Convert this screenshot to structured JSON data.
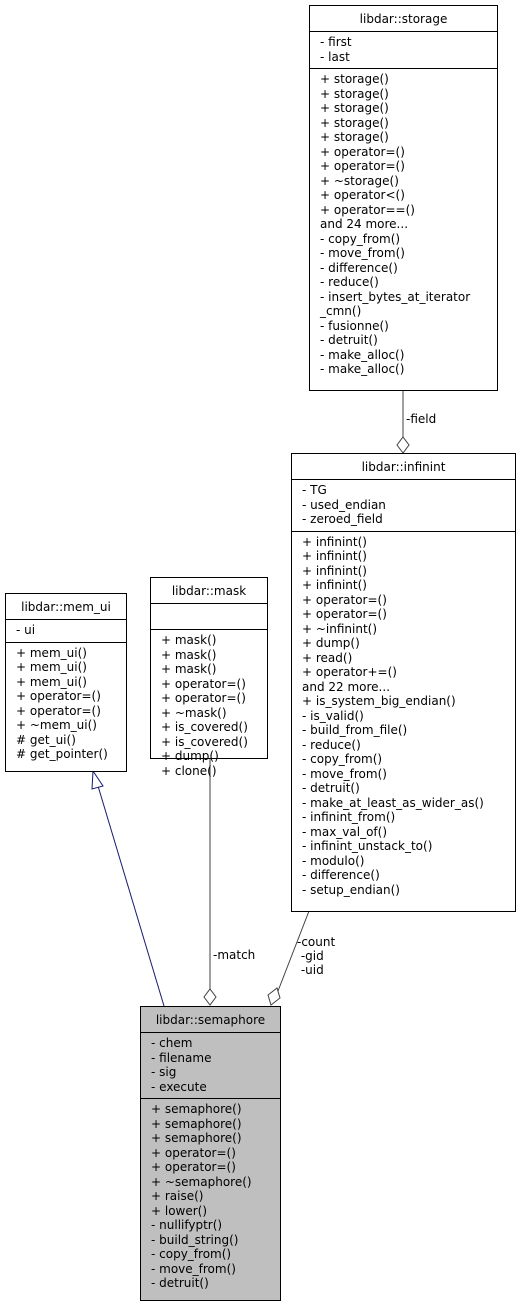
{
  "diagram": {
    "type": "uml-collaboration",
    "classes": {
      "storage": {
        "name": "libdar::storage",
        "attributes": [
          "- first",
          "- last"
        ],
        "methods": [
          "+ storage()",
          "+ storage()",
          "+ storage()",
          "+ storage()",
          "+ storage()",
          "+ operator=()",
          "+ operator=()",
          "+ ~storage()",
          "+ operator<()",
          "+ operator==()",
          "and 24 more...",
          "- copy_from()",
          "- move_from()",
          "- difference()",
          "- reduce()",
          "- insert_bytes_at_iterator",
          "_cmn()",
          "- fusionne()",
          "- detruit()",
          "- make_alloc()",
          "- make_alloc()"
        ]
      },
      "infinint": {
        "name": "libdar::infinint",
        "attributes": [
          "- TG",
          "- used_endian",
          "- zeroed_field"
        ],
        "methods": [
          "+ infinint()",
          "+ infinint()",
          "+ infinint()",
          "+ infinint()",
          "+ operator=()",
          "+ operator=()",
          "+ ~infinint()",
          "+ dump()",
          "+ read()",
          "+ operator+=()",
          "and 22 more...",
          "+ is_system_big_endian()",
          "- is_valid()",
          "- build_from_file()",
          "- reduce()",
          "- copy_from()",
          "- move_from()",
          "- detruit()",
          "- make_at_least_as_wider_as()",
          "- infinint_from()",
          "- max_val_of()",
          "- infinint_unstack_to()",
          "- modulo()",
          "- difference()",
          "- setup_endian()"
        ]
      },
      "mem_ui": {
        "name": "libdar::mem_ui",
        "attributes": [
          "- ui"
        ],
        "methods": [
          "+ mem_ui()",
          "+ mem_ui()",
          "+ mem_ui()",
          "+ operator=()",
          "+ operator=()",
          "+ ~mem_ui()",
          "# get_ui()",
          "# get_pointer()"
        ]
      },
      "mask": {
        "name": "libdar::mask",
        "attributes": [],
        "methods": [
          "+ mask()",
          "+ mask()",
          "+ mask()",
          "+ operator=()",
          "+ operator=()",
          "+ ~mask()",
          "+ is_covered()",
          "+ is_covered()",
          "+ dump()",
          "+ clone()"
        ]
      },
      "semaphore": {
        "name": "libdar::semaphore",
        "attributes": [
          "- chem",
          "- filename",
          "- sig",
          "- execute"
        ],
        "methods": [
          "+ semaphore()",
          "+ semaphore()",
          "+ semaphore()",
          "+ operator=()",
          "+ operator=()",
          "+ ~semaphore()",
          "+ raise()",
          "+ lower()",
          "- nullifyptr()",
          "- build_string()",
          "- copy_from()",
          "- move_from()",
          "- detruit()"
        ]
      }
    },
    "edges": [
      {
        "from": "storage",
        "to": "infinint",
        "kind": "composition",
        "label": "-field"
      },
      {
        "from": "mem_ui",
        "to": "semaphore",
        "kind": "inheritance",
        "label": ""
      },
      {
        "from": "mask",
        "to": "semaphore",
        "kind": "composition",
        "label": "-match"
      },
      {
        "from": "infinint",
        "to": "semaphore",
        "kind": "composition",
        "label": "-count\n -gid\n -uid"
      }
    ],
    "colors": {
      "highlight_fill": "#bfbfbf",
      "inheritance_edge": "#191970",
      "usage_edge": "#404040",
      "border": "#000000"
    }
  }
}
